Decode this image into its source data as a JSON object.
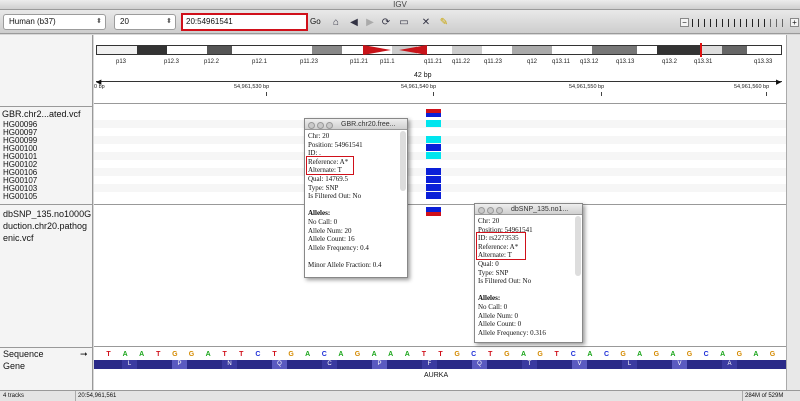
{
  "window": {
    "title": "IGV"
  },
  "toolbar": {
    "genome": "Human (b37)",
    "chromosome": "20",
    "locus": "20:54961541",
    "go_label": "Go"
  },
  "ideogram": {
    "bands": [
      "p13",
      "p12.3",
      "p12.2",
      "p12.1",
      "p11.23",
      "p11.21",
      "p11.1",
      "q11.21",
      "q11.22",
      "q11.23",
      "q12",
      "q13.11",
      "q13.12",
      "q13.13",
      "q13.2",
      "q13.31",
      "q13.33"
    ]
  },
  "ruler": {
    "span": "42 bp",
    "ticks": [
      "54,961,530 bp",
      "54,961,540 bp",
      "54,961,550 bp",
      "54,961,560 bp"
    ],
    "left_edge": "0 bp"
  },
  "tracks": {
    "vcf_name": "GBR.chr2...ated.vcf",
    "samples": [
      "HG00096",
      "HG00097",
      "HG00099",
      "HG00100",
      "HG00101",
      "HG00102",
      "HG00106",
      "HG00107",
      "HG00103",
      "HG00105"
    ],
    "dbsnp_name": "dbSNP_135.no1000G",
    "extra_1": "duction.chr20.pathog",
    "extra_2": "enic.vcf",
    "sequence_label": "Sequence",
    "gene_label": "Gene"
  },
  "popup1": {
    "title": "GBR.chr20.free...",
    "lines": [
      "Chr: 20",
      "Position: 54961541",
      "ID: .",
      "Reference: A*",
      "Alternate: T",
      "Qual: 14769.5",
      "Type: SNP",
      "Is Filtered Out: No",
      "",
      "Alleles:",
      "No Call: 0",
      "Allele Num: 20",
      "Allele Count: 16",
      "Allele Frequency: 0.4",
      "",
      "Minor Allele Fraction: 0.4"
    ]
  },
  "popup2": {
    "title": "dbSNP_135.no1...",
    "lines": [
      "Chr: 20",
      "Position: 54961541",
      "ID: rs2273535",
      "Reference: A*",
      "Alternate: T",
      "Qual: 0",
      "Type: SNP",
      "Is Filtered Out: No",
      "",
      "Alleles:",
      "No Call: 0",
      "Allele Num: 0",
      "Allele Count: 0",
      "Allele Frequency: 0.316"
    ]
  },
  "sequence": [
    "T",
    "A",
    "A",
    "T",
    "G",
    "G",
    "A",
    "T",
    "T",
    "C",
    "T",
    "G",
    "A",
    "C",
    "A",
    "G",
    "A",
    "A",
    "A",
    "T",
    "T",
    "G",
    "C",
    "T",
    "G",
    "A",
    "G",
    "T",
    "C",
    "A",
    "C",
    "G",
    "A",
    "G",
    "A",
    "G",
    "C",
    "A",
    "G",
    "A",
    "G"
  ],
  "gene": {
    "name": "AURKA",
    "aminoacids": [
      "L",
      "P",
      "N",
      "Q",
      "C",
      "P",
      "F",
      "Q",
      "T",
      "V",
      "L",
      "V",
      "A"
    ]
  },
  "status": {
    "tracks": "4 tracks",
    "position": "20:54,961,561",
    "memory": "284M of 529M"
  },
  "colors": {
    "het": "#00e5ee",
    "homvar": "#0a1fd8",
    "allele_red": "#d0101a",
    "gene": "#2a2a88"
  }
}
